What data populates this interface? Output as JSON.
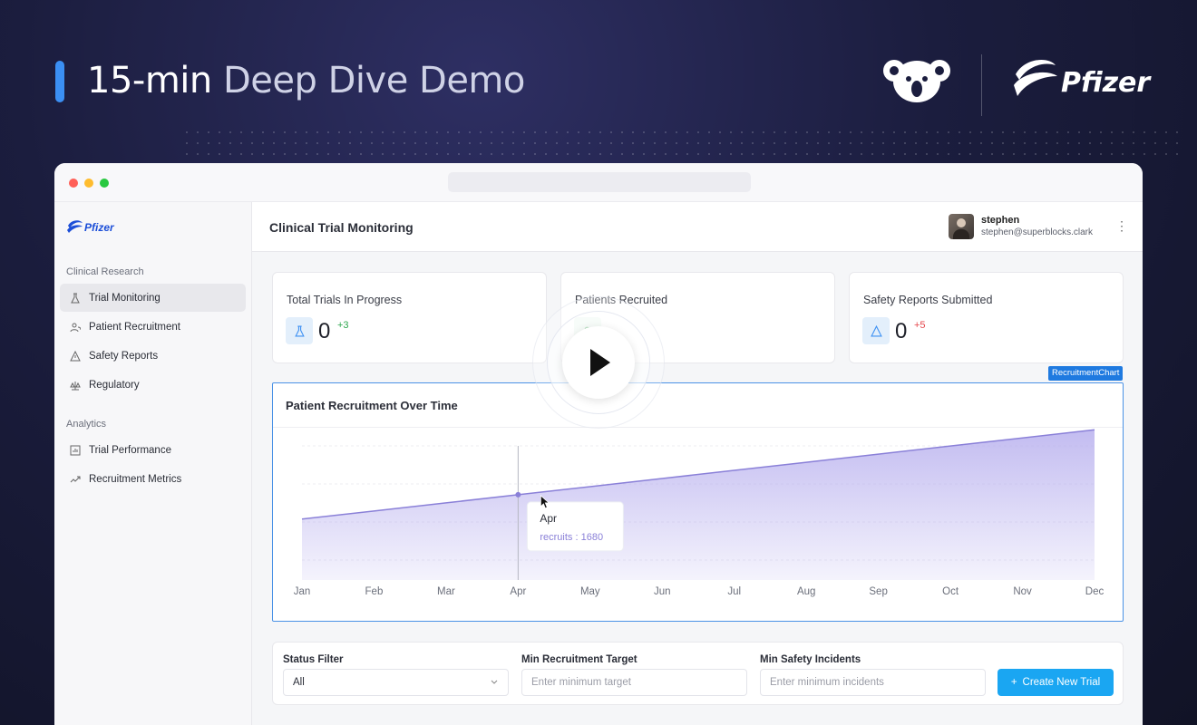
{
  "hero": {
    "title_bold": "15-min",
    "title_rest": "Deep Dive Demo",
    "brand_name": "Pfizer"
  },
  "sidebar": {
    "logo_text": "Pfizer",
    "sections": [
      {
        "label": "Clinical Research",
        "items": [
          {
            "label": "Trial Monitoring",
            "icon": "flask-icon",
            "active": true
          },
          {
            "label": "Patient Recruitment",
            "icon": "users-icon"
          },
          {
            "label": "Safety Reports",
            "icon": "warning-icon"
          },
          {
            "label": "Regulatory",
            "icon": "scale-icon"
          }
        ]
      },
      {
        "label": "Analytics",
        "items": [
          {
            "label": "Trial Performance",
            "icon": "chart-box-icon"
          },
          {
            "label": "Recruitment Metrics",
            "icon": "trend-icon"
          }
        ]
      }
    ]
  },
  "header": {
    "title": "Clinical Trial Monitoring",
    "user_name": "stephen",
    "user_email": "stephen@superblocks.clark"
  },
  "cards": [
    {
      "title": "Total Trials In Progress",
      "value": "0",
      "delta": "+3",
      "delta_color": "#2fa84f",
      "icon": "flask-icon"
    },
    {
      "title": "Patients Recruited",
      "value": "",
      "delta": "",
      "delta_color": "#2fa84f",
      "icon": "users-icon"
    },
    {
      "title": "Safety Reports Submitted",
      "value": "0",
      "delta": "+5",
      "delta_color": "#e5484d",
      "icon": "warning-icon"
    }
  ],
  "chart_tag": "RecruitmentChart",
  "chart_title": "Patient Recruitment Over Time",
  "chart_data": {
    "type": "area",
    "categories": [
      "Jan",
      "Feb",
      "Mar",
      "Apr",
      "May",
      "Jun",
      "Jul",
      "Aug",
      "Sep",
      "Oct",
      "Nov",
      "Dec"
    ],
    "series": [
      {
        "name": "recruits",
        "values": [
          1200,
          1360,
          1520,
          1680,
          1840,
          2000,
          2160,
          2320,
          2480,
          2640,
          2800,
          2960
        ]
      }
    ],
    "ylim": [
      0,
      3000
    ],
    "grid": true,
    "tooltip": {
      "category": "Apr",
      "label": "recruits : 1680"
    }
  },
  "filters": {
    "status_label": "Status Filter",
    "status_value": "All",
    "min_target_label": "Min Recruitment Target",
    "min_target_placeholder": "Enter minimum target",
    "min_incidents_label": "Min Safety Incidents",
    "min_incidents_placeholder": "Enter minimum incidents",
    "create_button": "Create New Trial"
  },
  "colors": {
    "accent": "#1aa6f2",
    "chart_line": "#8a80d8",
    "chart_fill": "#b8b0ee",
    "selection": "#4a92e6"
  }
}
